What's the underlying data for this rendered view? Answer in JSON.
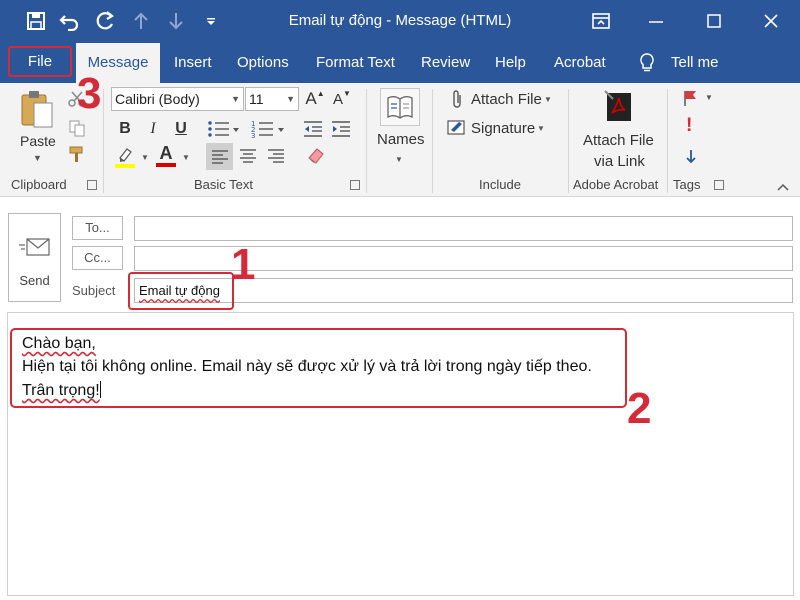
{
  "window": {
    "title": "Email tự động  -  Message (HTML)"
  },
  "qat": {
    "icons": [
      "save-icon",
      "undo-icon",
      "redo-icon",
      "up-arrow-icon",
      "down-arrow-icon",
      "customize-icon"
    ]
  },
  "tabs": {
    "file": "File",
    "message": "Message",
    "insert": "Insert",
    "options": "Options",
    "format_text": "Format Text",
    "review": "Review",
    "help": "Help",
    "acrobat": "Acrobat",
    "tell_me": "Tell me"
  },
  "ribbon": {
    "clipboard": {
      "paste": "Paste",
      "label": "Clipboard"
    },
    "basic_text": {
      "font": "Calibri (Body)",
      "size": "11",
      "label": "Basic Text",
      "bold": "B",
      "italic": "I",
      "underline": "U",
      "font_color_letter": "A",
      "grow_letter": "A",
      "shrink_letter": "A"
    },
    "names": {
      "label": "Names"
    },
    "include": {
      "attach_file": "Attach File",
      "signature": "Signature",
      "label": "Include"
    },
    "adobe": {
      "attach_line1": "Attach File",
      "attach_line2": "via Link",
      "label": "Adobe Acrobat"
    },
    "tags": {
      "label": "Tags"
    }
  },
  "compose": {
    "send": "Send",
    "to_button": "To...",
    "cc_button": "Cc...",
    "subject_label": "Subject",
    "subject_value": "Email tự động"
  },
  "body": {
    "line1": "Chào bạn,",
    "line2": "Hiện tại tôi không online. Email này sẽ được xử lý và trả lời trong ngày tiếp theo.",
    "line3": "Trân trọng!"
  },
  "annotations": {
    "n1": "1",
    "n2": "2",
    "n3": "3"
  },
  "colors": {
    "accent": "#2b579a",
    "highlight": "#d42b3a",
    "ribbon_bg": "#f3f3f3"
  }
}
